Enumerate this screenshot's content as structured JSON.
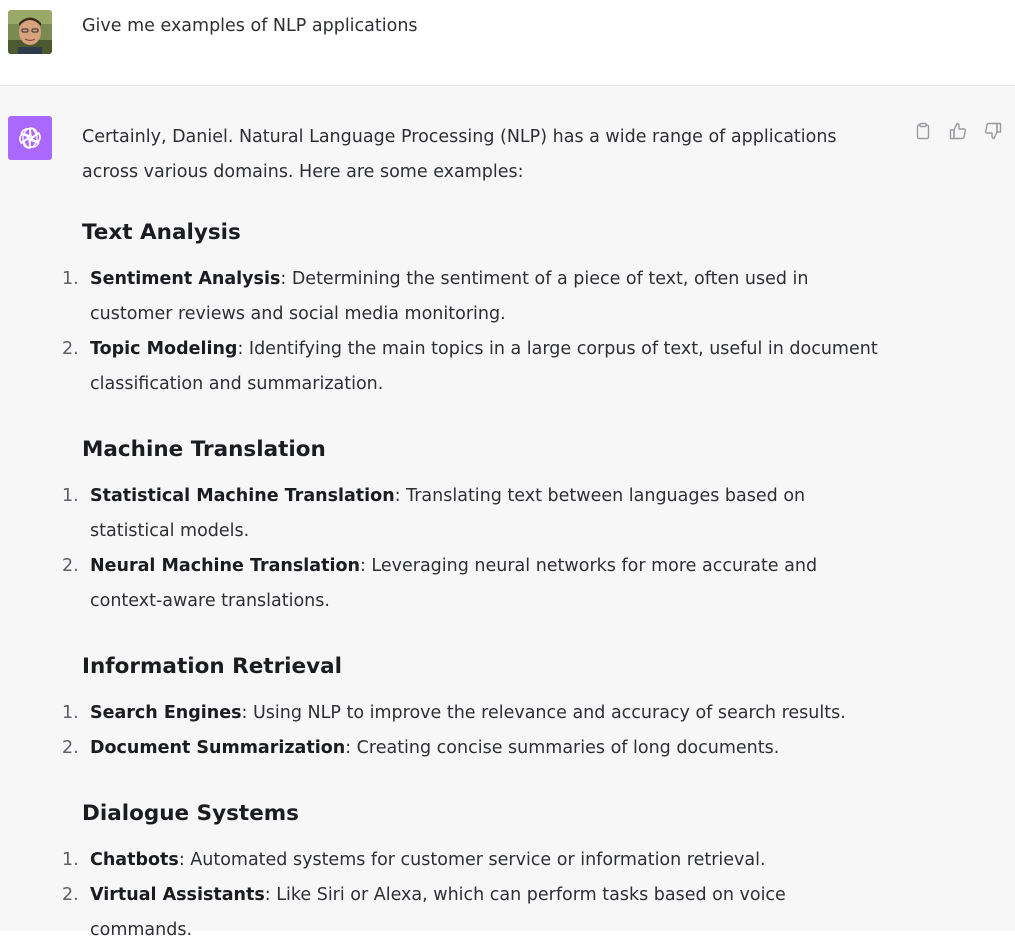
{
  "user": {
    "message": "Give me examples of NLP applications"
  },
  "assistant": {
    "intro": "Certainly, Daniel. Natural Language Processing (NLP) has a wide range of applications across various domains. Here are some examples:",
    "sections": [
      {
        "title": "Text Analysis",
        "items": [
          {
            "num": "1.",
            "term": "Sentiment Analysis",
            "desc": ": Determining the sentiment of a piece of text, often used in customer reviews and social media monitoring."
          },
          {
            "num": "2.",
            "term": "Topic Modeling",
            "desc": ": Identifying the main topics in a large corpus of text, useful in document classification and summarization."
          }
        ]
      },
      {
        "title": "Machine Translation",
        "items": [
          {
            "num": "1.",
            "term": "Statistical Machine Translation",
            "desc": ": Translating text between languages based on statistical models."
          },
          {
            "num": "2.",
            "term": "Neural Machine Translation",
            "desc": ": Leveraging neural networks for more accurate and context-aware translations."
          }
        ]
      },
      {
        "title": "Information Retrieval",
        "items": [
          {
            "num": "1.",
            "term": "Search Engines",
            "desc": ": Using NLP to improve the relevance and accuracy of search results."
          },
          {
            "num": "2.",
            "term": "Document Summarization",
            "desc": ": Creating concise summaries of long documents."
          }
        ]
      },
      {
        "title": "Dialogue Systems",
        "items": [
          {
            "num": "1.",
            "term": "Chatbots",
            "desc": ": Automated systems for customer service or information retrieval."
          },
          {
            "num": "2.",
            "term": "Virtual Assistants",
            "desc": ": Like Siri or Alexa, which can perform tasks based on voice commands."
          }
        ]
      }
    ]
  },
  "icons": {
    "copy": "clipboard-icon",
    "like": "thumbs-up-icon",
    "dislike": "thumbs-down-icon",
    "logo": "openai-logo-icon"
  },
  "colors": {
    "assistant_bg": "#f7f7f8",
    "logo_bg": "#ab68ff"
  }
}
